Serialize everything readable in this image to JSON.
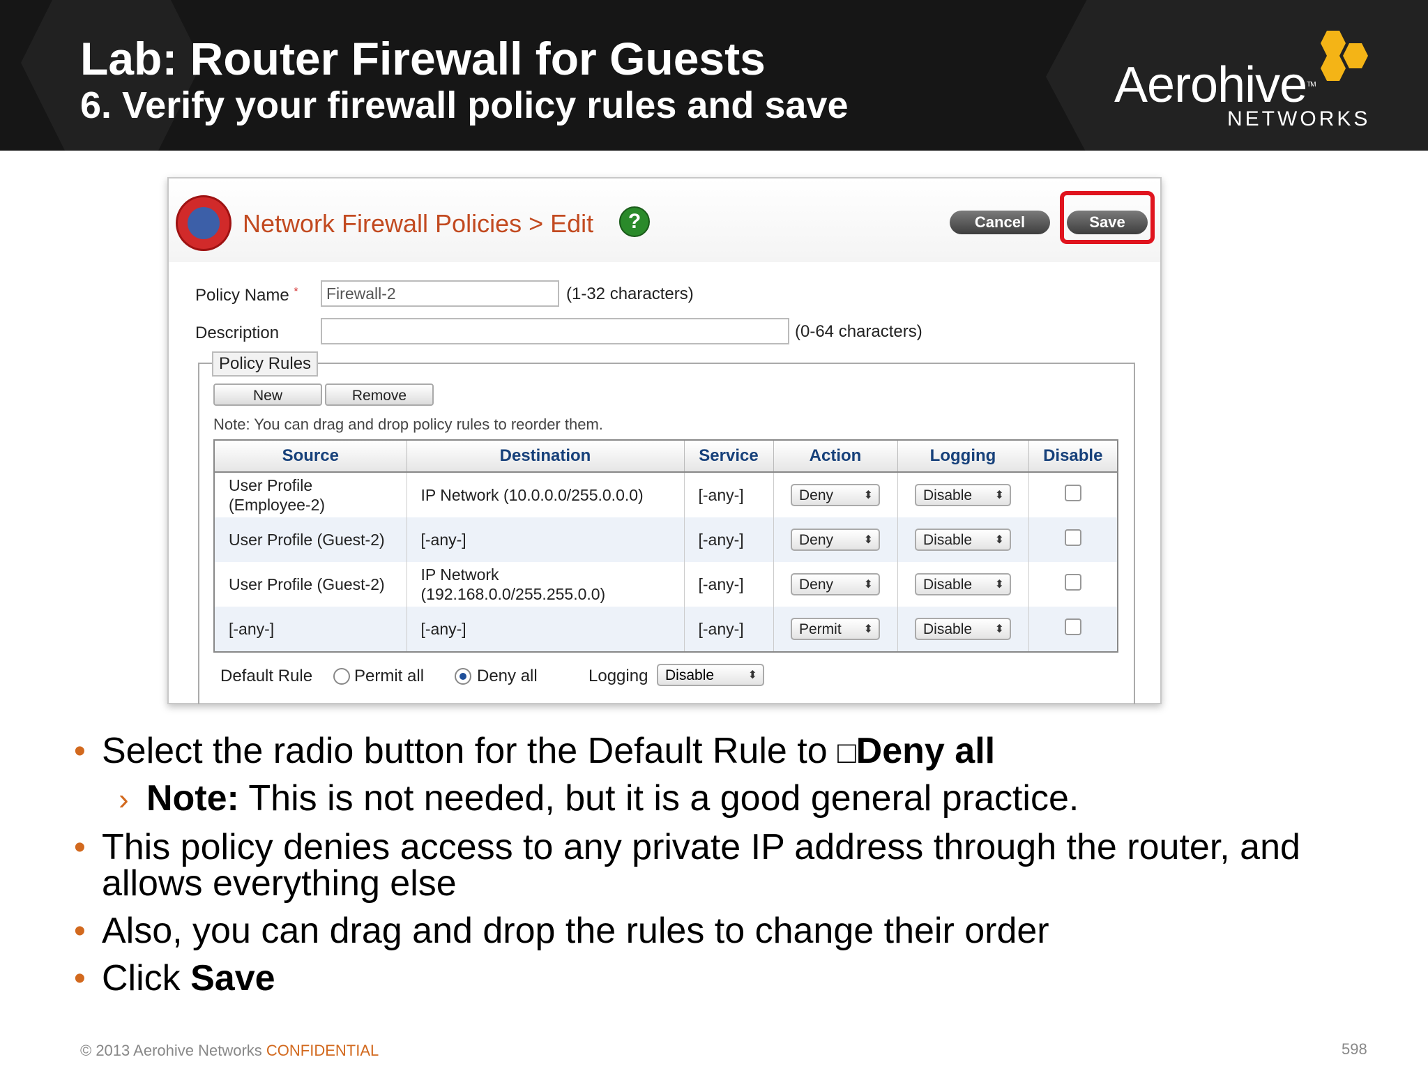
{
  "header": {
    "title": "Lab: Router Firewall for Guests",
    "subtitle": "6. Verify your firewall policy rules and save",
    "logo_name": "Aerohive",
    "logo_tm": "TM",
    "logo_sub": "NETWORKS"
  },
  "app": {
    "title": "Network Firewall Policies > Edit",
    "help": "?",
    "cancel_label": "Cancel",
    "save_label": "Save"
  },
  "form": {
    "policy_name_label": "Policy Name",
    "required_mark": "*",
    "policy_name_value": "Firewall-2",
    "policy_name_hint": "(1-32 characters)",
    "description_label": "Description",
    "description_value": "",
    "description_hint": "(0-64 characters)"
  },
  "rules": {
    "legend": "Policy Rules",
    "new_label": "New",
    "remove_label": "Remove",
    "note": "Note: You can drag and drop policy rules to reorder them.",
    "columns": [
      "Source",
      "Destination",
      "Service",
      "Action",
      "Logging",
      "Disable"
    ],
    "rows": [
      {
        "source": "User Profile (Employee-2)",
        "destination": "IP Network (10.0.0.0/255.0.0.0)",
        "service": "[-any-]",
        "action": "Deny",
        "logging": "Disable"
      },
      {
        "source": "User Profile (Guest-2)",
        "destination": "[-any-]",
        "service": "[-any-]",
        "action": "Deny",
        "logging": "Disable"
      },
      {
        "source": "User Profile (Guest-2)",
        "destination": "IP Network (192.168.0.0/255.255.0.0)",
        "service": "[-any-]",
        "action": "Deny",
        "logging": "Disable"
      },
      {
        "source": "[-any-]",
        "destination": "[-any-]",
        "service": "[-any-]",
        "action": "Permit",
        "logging": "Disable"
      }
    ],
    "select_arrow": "⬍"
  },
  "default_rule": {
    "label": "Default Rule",
    "permit_label": "Permit all",
    "deny_label": "Deny all",
    "selected": "Deny all",
    "logging_label": "Logging",
    "logging_value": "Disable"
  },
  "bullets": {
    "b1_text": "Select the radio button for the  Default Rule to ",
    "b1_box": "□",
    "b1_bold": "Deny all",
    "sub_marker": "›",
    "sub_bold": "Note:",
    "sub_text": " This is not needed, but it is a good general practice.",
    "b2_line1": "This policy denies access to any private IP address through the router, and",
    "b2_line2": "allows everything else",
    "b3_text": "Also, you can drag and drop the rules to change their order",
    "b4_text": "Click ",
    "b4_bold": "Save",
    "bullet_char": "•"
  },
  "footer": {
    "copyright": "© 2013 Aerohive Networks ",
    "confidential": "CONFIDENTIAL",
    "page_number": "598"
  },
  "colors": {
    "header_bg": "#161616",
    "accent_orange": "#d2691e",
    "logo_yellow": "#f4b416",
    "save_highlight": "#e0141e"
  }
}
